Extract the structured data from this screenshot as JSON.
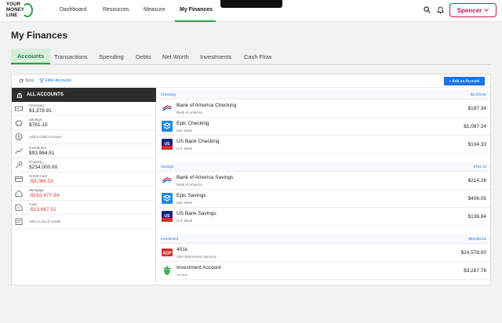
{
  "app": {
    "logo_lines": [
      "YOUR",
      "MONEY",
      "LINE"
    ]
  },
  "nav": {
    "items": [
      {
        "label": "Dashboard"
      },
      {
        "label": "Resources"
      },
      {
        "label": "Measure"
      },
      {
        "label": "My Finances"
      }
    ],
    "user_label": "Spencer"
  },
  "page": {
    "title": "My Finances",
    "tabs": [
      {
        "label": "Accounts"
      },
      {
        "label": "Transactions"
      },
      {
        "label": "Spending"
      },
      {
        "label": "Debts"
      },
      {
        "label": "Net Worth"
      },
      {
        "label": "Investments"
      },
      {
        "label": "Cash Flow"
      }
    ]
  },
  "toolbar": {
    "sync_label": "Sync",
    "filter_label": "Filter Accounts",
    "add_label": "+ Add an Account"
  },
  "sidebar": {
    "header": "ALL ACCOUNTS",
    "items": [
      {
        "label": "Checking",
        "value": "$1,378.91",
        "icon": "checking-icon"
      },
      {
        "label": "Savings",
        "value": "$761.15",
        "icon": "piggy-bank-icon"
      },
      {
        "label": "",
        "action": "Add a Cash Account",
        "icon": "cash-icon"
      },
      {
        "label": "Investment",
        "value": "$93,964.51",
        "icon": "chart-icon"
      },
      {
        "label": "Property",
        "value": "$234,000.00",
        "icon": "key-icon"
      },
      {
        "label": "Credit Card",
        "value": "-$9,066.53",
        "icon": "credit-card-icon"
      },
      {
        "label": "Mortgage",
        "value": "-$162,477.84",
        "icon": "house-icon"
      },
      {
        "label": "Loan",
        "value": "-$13,667.51",
        "icon": "loan-icon"
      },
      {
        "label": "",
        "action": "Add a Line of Credit",
        "icon": "line-of-credit-icon"
      }
    ]
  },
  "groups": [
    {
      "name": "Checking",
      "total": "$1,378.91",
      "accounts": [
        {
          "name": "Bank of America Checking",
          "institution": "Bank of America",
          "balance": "$187.34",
          "logo": "bank-of-america-logo"
        },
        {
          "name": "Epic Checking",
          "institution": "Epic Bank",
          "balance": "$1,087.24",
          "logo": "epic-bank-logo"
        },
        {
          "name": "US Bank Checking",
          "institution": "U.S. Bank",
          "balance": "$104.33",
          "logo": "us-bank-logo"
        }
      ]
    },
    {
      "name": "Savings",
      "total": "$761.15",
      "accounts": [
        {
          "name": "Bank of America Savings",
          "institution": "Bank of America",
          "balance": "$214.26",
          "logo": "bank-of-america-logo"
        },
        {
          "name": "Epic Savings",
          "institution": "Epic Bank",
          "balance": "$408.05",
          "logo": "epic-bank-logo"
        },
        {
          "name": "US Bank Savings",
          "institution": "U.S. Bank",
          "balance": "$138.84",
          "logo": "us-bank-logo"
        }
      ]
    },
    {
      "name": "Investment",
      "total": "$93,964.51",
      "accounts": [
        {
          "name": "401k",
          "institution": "ADP Retirement Services",
          "balance": "$24,578.00",
          "logo": "adp-logo"
        },
        {
          "name": "Investment Account",
          "institution": "Acorns",
          "balance": "$3,287.78",
          "logo": "acorns-logo"
        }
      ]
    }
  ],
  "colors": {
    "brand_green": "#2e9e4f",
    "accent_blue": "#1a73e8",
    "user_magenta": "#c2185b",
    "negative_red": "#e53935"
  }
}
